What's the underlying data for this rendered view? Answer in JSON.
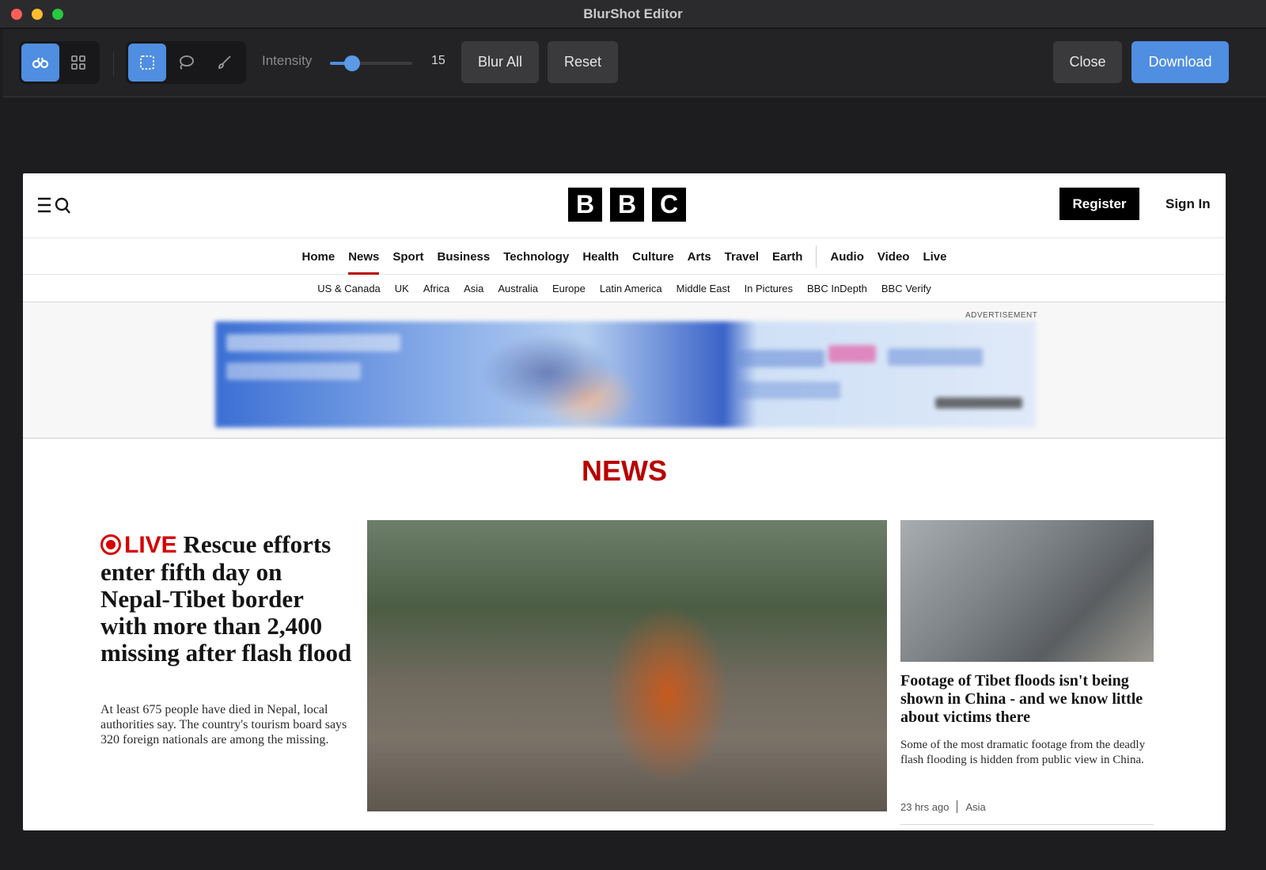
{
  "window": {
    "title": "BlurShot Editor"
  },
  "toolbar": {
    "mode_tools": [
      {
        "icon": "binoculars-icon",
        "active": true
      },
      {
        "icon": "grid-icon",
        "active": false
      }
    ],
    "select_tools": [
      {
        "icon": "rectangle-select-icon",
        "active": true
      },
      {
        "icon": "lasso-icon",
        "active": false
      },
      {
        "icon": "brush-icon",
        "active": false
      }
    ],
    "intensity_label": "Intensity",
    "intensity_value": "15",
    "intensity_fraction": 0.27,
    "blur_all_label": "Blur All",
    "reset_label": "Reset",
    "close_label": "Close",
    "download_label": "Download",
    "accent_color": "#4f8ee0"
  },
  "page": {
    "logo_letters": [
      "B",
      "B",
      "C"
    ],
    "register_label": "Register",
    "signin_label": "Sign In",
    "main_nav": [
      "Home",
      "News",
      "Sport",
      "Business",
      "Technology",
      "Health",
      "Culture",
      "Arts",
      "Travel",
      "Earth",
      "Audio",
      "Video",
      "Live"
    ],
    "main_nav_current": "News",
    "sub_nav": [
      "US & Canada",
      "UK",
      "Africa",
      "Asia",
      "Australia",
      "Europe",
      "Latin America",
      "Middle East",
      "In Pictures",
      "BBC InDepth",
      "BBC Verify"
    ],
    "ad_label": "ADVERTISEMENT",
    "section_title": "NEWS",
    "lead": {
      "live_label": "LIVE",
      "headline": "Rescue efforts enter fifth day on Nepal-Tibet border with more than 2,400 missing after flash flood",
      "summary": "At least 675 people have died in Nepal, local authorities say. The country's tourism board says 320 foreign nationals are among the missing.",
      "image": "rescue-worker-photo"
    },
    "side": {
      "headline": "Footage of Tibet floods isn't being shown in China - and we know little about victims there",
      "summary": "Some of the most dramatic footage from the deadly flash flooding is hidden from public view in China.",
      "time": "23 hrs ago",
      "tag": "Asia",
      "image": "flood-footage-photo"
    },
    "brand_color": "#b80000"
  }
}
